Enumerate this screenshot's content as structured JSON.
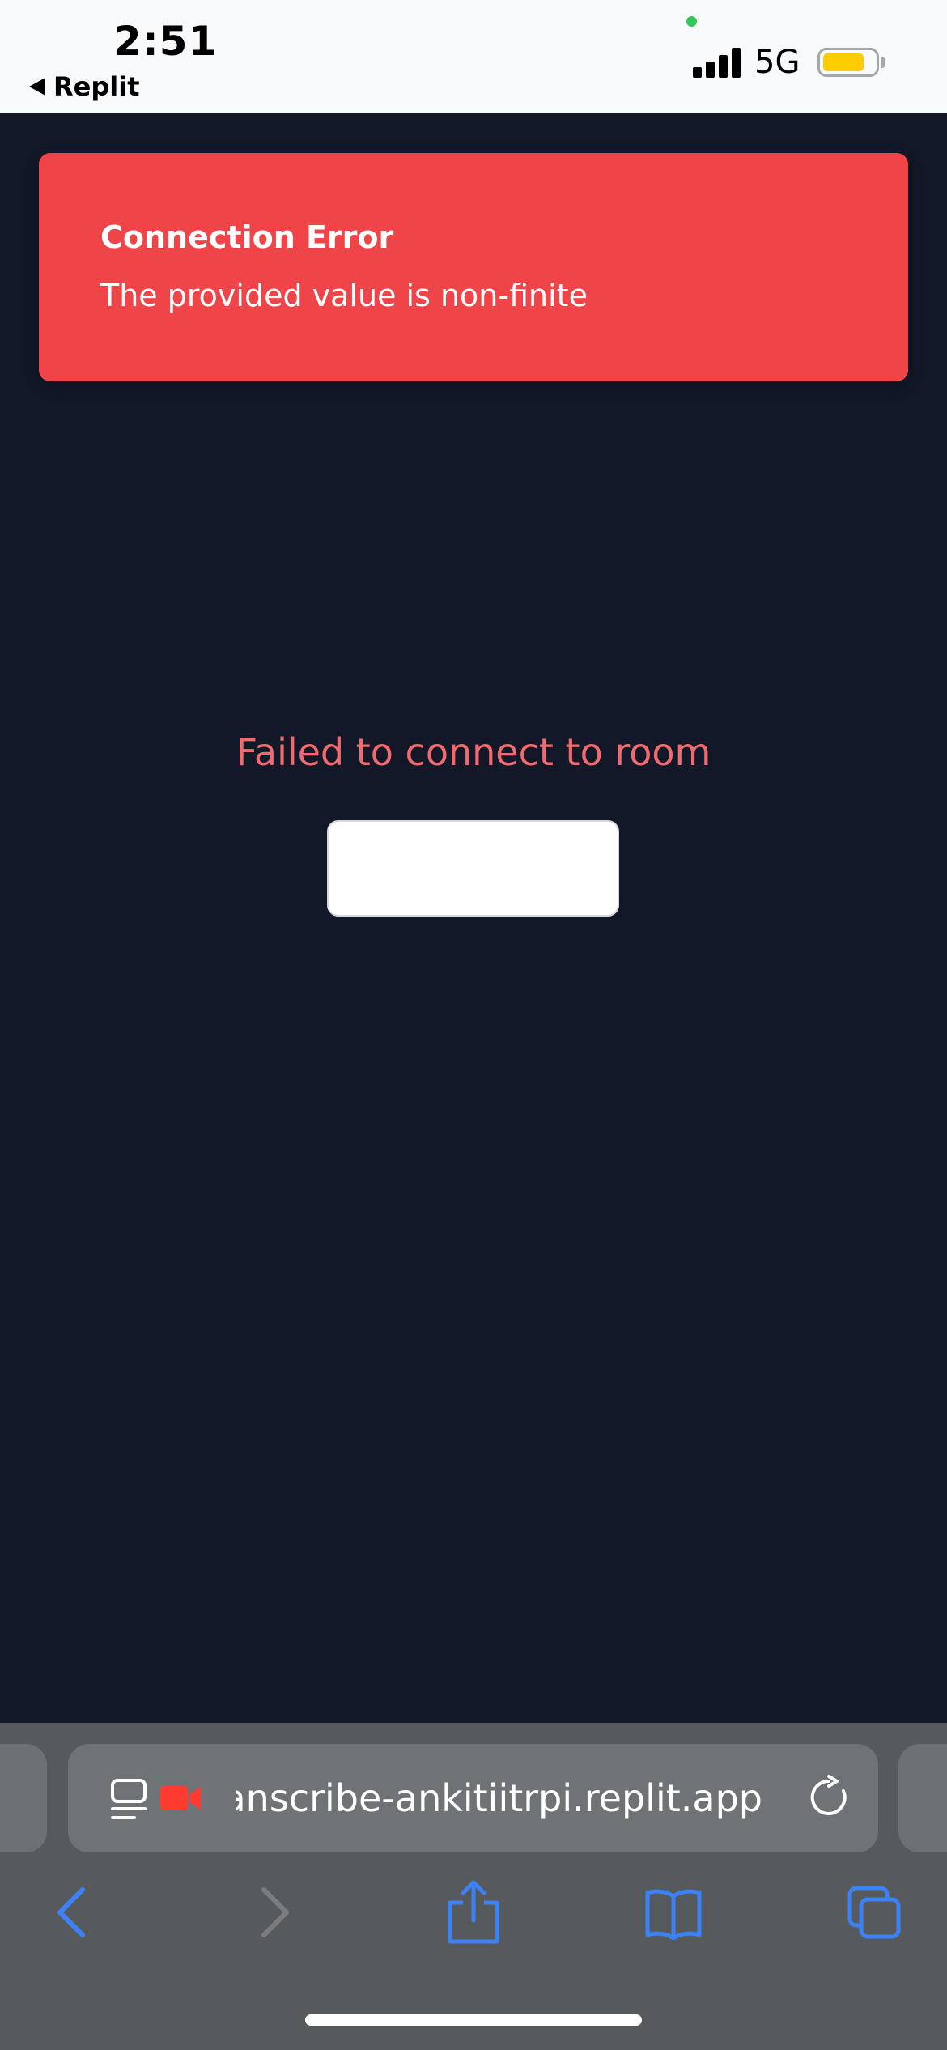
{
  "status_bar": {
    "time": "2:51",
    "back_app": "Replit",
    "network": "5G",
    "battery_color": "#ffcc00"
  },
  "toast": {
    "title": "Connection Error",
    "message": "The provided value is non-finite",
    "background": "#ef4549"
  },
  "main": {
    "status_message": "Failed to connect to room",
    "button_label": ""
  },
  "safari": {
    "url": "anscribe-ankitiitrpi.replit.app",
    "icons": {
      "reader": "reader-icon",
      "camera": "camera-recording-icon",
      "reload": "reload-icon",
      "back": "back-icon",
      "forward": "forward-icon",
      "share": "share-icon",
      "bookmarks": "bookmarks-icon",
      "tabs": "tabs-icon"
    }
  }
}
